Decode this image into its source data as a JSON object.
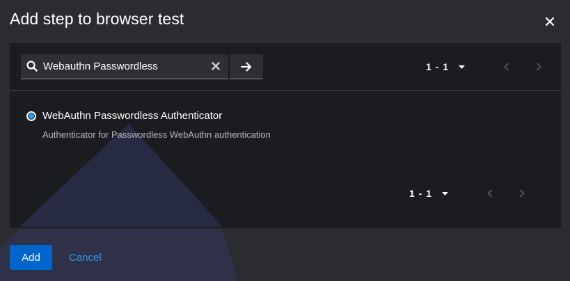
{
  "modal": {
    "title": "Add step to browser test"
  },
  "search": {
    "value": "Webauthn Passwordless"
  },
  "pagination": {
    "range": "1 - 1"
  },
  "options": [
    {
      "label": "WebAuthn Passwordless Authenticator",
      "description": "Authenticator for Passwordless WebAuthn authentication",
      "selected": true
    }
  ],
  "footer": {
    "add_label": "Add",
    "cancel_label": "Cancel"
  },
  "colors": {
    "primary": "#0066cc",
    "link": "#2b9af3",
    "background": "#2b2c30",
    "panel": "#1b1c20"
  }
}
